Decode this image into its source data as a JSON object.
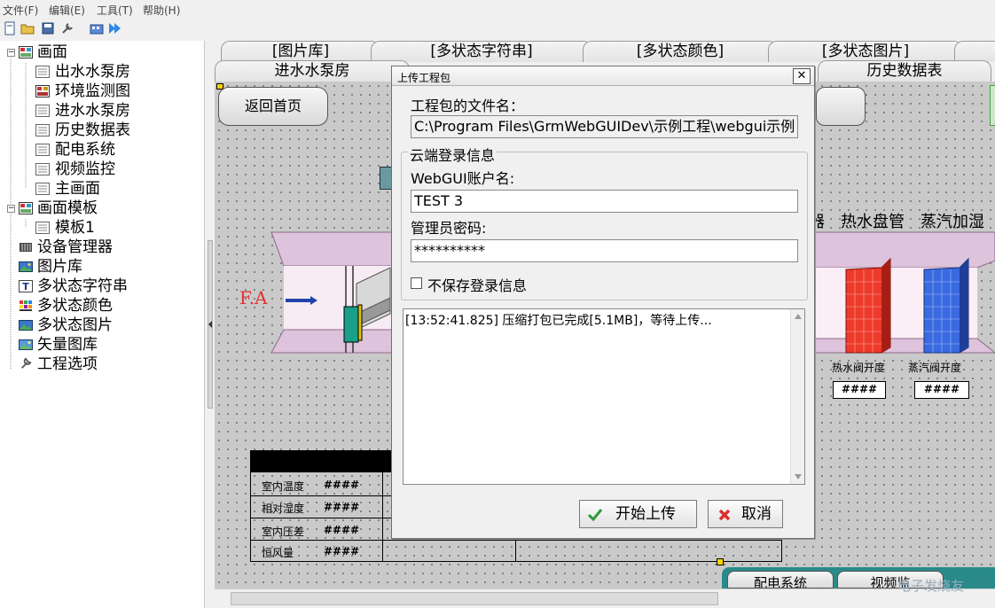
{
  "menu": [
    {
      "label": "文件(F)"
    },
    {
      "label": "编辑(E)"
    },
    {
      "label": "工具(T)"
    },
    {
      "label": "帮助(H)"
    }
  ],
  "toolbar": {
    "icons": [
      "new-icon",
      "open-icon",
      "save-icon",
      "tool-icon",
      "build-icon",
      "run-icon"
    ]
  },
  "tree": {
    "items": [
      {
        "label": "画面",
        "icon": "screen-folder-icon",
        "expanded": true
      },
      {
        "label": "出水水泵房",
        "icon": "screen-icon"
      },
      {
        "label": "环境监测图",
        "icon": "screen-icon-active"
      },
      {
        "label": "进水水泵房",
        "icon": "screen-icon"
      },
      {
        "label": "历史数据表",
        "icon": "screen-icon"
      },
      {
        "label": "配电系统",
        "icon": "screen-icon"
      },
      {
        "label": "视频监控",
        "icon": "screen-icon"
      },
      {
        "label": "主画面",
        "icon": "screen-icon"
      },
      {
        "label": "画面模板",
        "icon": "template-folder-icon",
        "expanded": true
      },
      {
        "label": "模板1",
        "icon": "screen-icon"
      },
      {
        "label": "设备管理器",
        "icon": "device-manager-icon"
      },
      {
        "label": "图片库",
        "icon": "picture-library-icon"
      },
      {
        "label": "多状态字符串",
        "icon": "multistate-string-icon"
      },
      {
        "label": "多状态颜色",
        "icon": "multistate-color-icon"
      },
      {
        "label": "多状态图片",
        "icon": "multistate-image-icon"
      },
      {
        "label": "矢量图库",
        "icon": "vector-library-icon"
      },
      {
        "label": "工程选项",
        "icon": "project-options-icon"
      }
    ]
  },
  "tabs_row1": [
    {
      "label": "[图片库]"
    },
    {
      "label": "[多状态字符串]"
    },
    {
      "label": "[多状态颜色]"
    },
    {
      "label": "[多状态图片]"
    }
  ],
  "tabs_row2": [
    {
      "label": "进水水泵房"
    },
    {
      "label": "历史数据表"
    }
  ],
  "canvas": {
    "back_button": "返回首页",
    "fa_label": "F.A",
    "header_text": "器　热水盘管　蒸汽加湿",
    "hot_valve_label": "热水阀开度",
    "steam_valve_label": "蒸汽阀开度",
    "hot_valve_value": "####",
    "steam_valve_value": "####",
    "table_rows": [
      {
        "label": "室内温度",
        "value": "####"
      },
      {
        "label": "相对湿度",
        "value": "####"
      },
      {
        "label": "室内压差",
        "value": "####"
      },
      {
        "label": "恒风量",
        "value": "####"
      }
    ],
    "bottom_tab_1": "配电系统",
    "bottom_tab_2": "视频监"
  },
  "dialog": {
    "title": "上传工程包",
    "filename_label": "工程包的文件名：",
    "filename_value": "C:\\Program Files\\GrmWebGUIDev\\示例工程\\webgui示例",
    "group_label": "云端登录信息",
    "account_label": "WebGUI账户名:",
    "account_value": "TEST 3",
    "password_label": "管理员密码:",
    "password_value": "**********",
    "nosave_label": "不保存登录信息",
    "nosave_checked": false,
    "log": "[13:52:41.825] 压缩打包已完成[5.1MB]，等待上传...",
    "upload_button": "开始上传",
    "cancel_button": "取消",
    "close_glyph": "✕"
  },
  "watermark": "电子发烧友"
}
